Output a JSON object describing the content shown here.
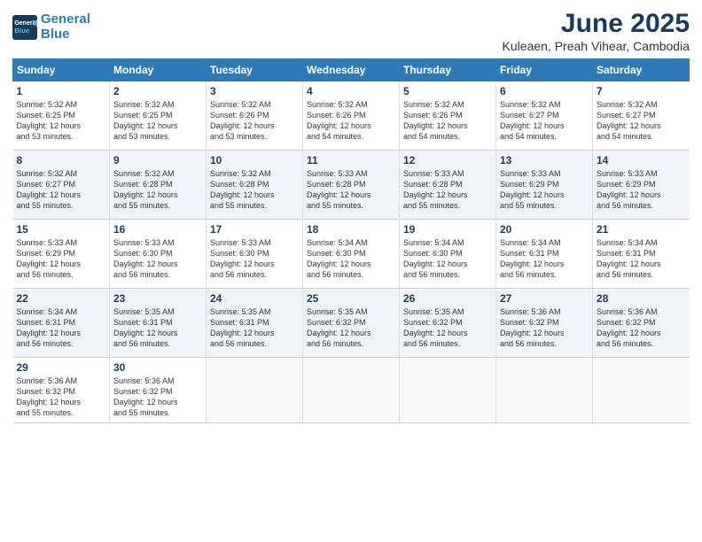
{
  "header": {
    "logo_line1": "General",
    "logo_line2": "Blue",
    "title": "June 2025",
    "subtitle": "Kuleaen, Preah Vihear, Cambodia"
  },
  "days_of_week": [
    "Sunday",
    "Monday",
    "Tuesday",
    "Wednesday",
    "Thursday",
    "Friday",
    "Saturday"
  ],
  "weeks": [
    [
      {
        "day": "1",
        "info": "Sunrise: 5:32 AM\nSunset: 6:25 PM\nDaylight: 12 hours\nand 53 minutes."
      },
      {
        "day": "2",
        "info": "Sunrise: 5:32 AM\nSunset: 6:25 PM\nDaylight: 12 hours\nand 53 minutes."
      },
      {
        "day": "3",
        "info": "Sunrise: 5:32 AM\nSunset: 6:26 PM\nDaylight: 12 hours\nand 53 minutes."
      },
      {
        "day": "4",
        "info": "Sunrise: 5:32 AM\nSunset: 6:26 PM\nDaylight: 12 hours\nand 54 minutes."
      },
      {
        "day": "5",
        "info": "Sunrise: 5:32 AM\nSunset: 6:26 PM\nDaylight: 12 hours\nand 54 minutes."
      },
      {
        "day": "6",
        "info": "Sunrise: 5:32 AM\nSunset: 6:27 PM\nDaylight: 12 hours\nand 54 minutes."
      },
      {
        "day": "7",
        "info": "Sunrise: 5:32 AM\nSunset: 6:27 PM\nDaylight: 12 hours\nand 54 minutes."
      }
    ],
    [
      {
        "day": "8",
        "info": "Sunrise: 5:32 AM\nSunset: 6:27 PM\nDaylight: 12 hours\nand 55 minutes."
      },
      {
        "day": "9",
        "info": "Sunrise: 5:32 AM\nSunset: 6:28 PM\nDaylight: 12 hours\nand 55 minutes."
      },
      {
        "day": "10",
        "info": "Sunrise: 5:32 AM\nSunset: 6:28 PM\nDaylight: 12 hours\nand 55 minutes."
      },
      {
        "day": "11",
        "info": "Sunrise: 5:33 AM\nSunset: 6:28 PM\nDaylight: 12 hours\nand 55 minutes."
      },
      {
        "day": "12",
        "info": "Sunrise: 5:33 AM\nSunset: 6:28 PM\nDaylight: 12 hours\nand 55 minutes."
      },
      {
        "day": "13",
        "info": "Sunrise: 5:33 AM\nSunset: 6:29 PM\nDaylight: 12 hours\nand 55 minutes."
      },
      {
        "day": "14",
        "info": "Sunrise: 5:33 AM\nSunset: 6:29 PM\nDaylight: 12 hours\nand 56 minutes."
      }
    ],
    [
      {
        "day": "15",
        "info": "Sunrise: 5:33 AM\nSunset: 6:29 PM\nDaylight: 12 hours\nand 56 minutes."
      },
      {
        "day": "16",
        "info": "Sunrise: 5:33 AM\nSunset: 6:30 PM\nDaylight: 12 hours\nand 56 minutes."
      },
      {
        "day": "17",
        "info": "Sunrise: 5:33 AM\nSunset: 6:30 PM\nDaylight: 12 hours\nand 56 minutes."
      },
      {
        "day": "18",
        "info": "Sunrise: 5:34 AM\nSunset: 6:30 PM\nDaylight: 12 hours\nand 56 minutes."
      },
      {
        "day": "19",
        "info": "Sunrise: 5:34 AM\nSunset: 6:30 PM\nDaylight: 12 hours\nand 56 minutes."
      },
      {
        "day": "20",
        "info": "Sunrise: 5:34 AM\nSunset: 6:31 PM\nDaylight: 12 hours\nand 56 minutes."
      },
      {
        "day": "21",
        "info": "Sunrise: 5:34 AM\nSunset: 6:31 PM\nDaylight: 12 hours\nand 56 minutes."
      }
    ],
    [
      {
        "day": "22",
        "info": "Sunrise: 5:34 AM\nSunset: 6:31 PM\nDaylight: 12 hours\nand 56 minutes."
      },
      {
        "day": "23",
        "info": "Sunrise: 5:35 AM\nSunset: 6:31 PM\nDaylight: 12 hours\nand 56 minutes."
      },
      {
        "day": "24",
        "info": "Sunrise: 5:35 AM\nSunset: 6:31 PM\nDaylight: 12 hours\nand 56 minutes."
      },
      {
        "day": "25",
        "info": "Sunrise: 5:35 AM\nSunset: 6:32 PM\nDaylight: 12 hours\nand 56 minutes."
      },
      {
        "day": "26",
        "info": "Sunrise: 5:35 AM\nSunset: 6:32 PM\nDaylight: 12 hours\nand 56 minutes."
      },
      {
        "day": "27",
        "info": "Sunrise: 5:36 AM\nSunset: 6:32 PM\nDaylight: 12 hours\nand 56 minutes."
      },
      {
        "day": "28",
        "info": "Sunrise: 5:36 AM\nSunset: 6:32 PM\nDaylight: 12 hours\nand 56 minutes."
      }
    ],
    [
      {
        "day": "29",
        "info": "Sunrise: 5:36 AM\nSunset: 6:32 PM\nDaylight: 12 hours\nand 55 minutes."
      },
      {
        "day": "30",
        "info": "Sunrise: 5:36 AM\nSunset: 6:32 PM\nDaylight: 12 hours\nand 55 minutes."
      },
      {
        "day": "",
        "info": ""
      },
      {
        "day": "",
        "info": ""
      },
      {
        "day": "",
        "info": ""
      },
      {
        "day": "",
        "info": ""
      },
      {
        "day": "",
        "info": ""
      }
    ]
  ]
}
